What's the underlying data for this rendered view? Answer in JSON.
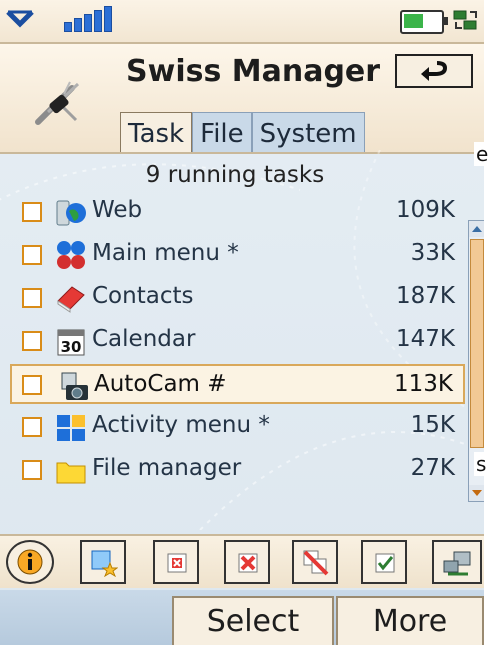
{
  "status_bar": {
    "signal_icon": "signal-strength-icon",
    "battery_level": 0.6
  },
  "header": {
    "title": "Swiss Manager",
    "back_icon": "back-arrow-icon"
  },
  "tabs": [
    {
      "label": "Task"
    },
    {
      "label": "File"
    },
    {
      "label": "System"
    }
  ],
  "active_tab": "Task",
  "summary": "9 running tasks",
  "tasks": [
    {
      "name": "Web",
      "size": "109K",
      "icon": "globe-phone-icon"
    },
    {
      "name": "Main menu *",
      "size": "33K",
      "icon": "main-menu-icon"
    },
    {
      "name": "Contacts",
      "size": "187K",
      "icon": "contacts-book-icon"
    },
    {
      "name": "Calendar",
      "size": "147K",
      "icon": "calendar-icon"
    },
    {
      "name": "AutoCam #",
      "size": "113K",
      "icon": "camera-icon"
    },
    {
      "name": "Activity menu *",
      "size": "15K",
      "icon": "activity-menu-icon"
    },
    {
      "name": "File manager",
      "size": "27K",
      "icon": "folder-icon"
    }
  ],
  "selected_task_index": 4,
  "edge_text": {
    "left_top": "e",
    "left_bottom": "s"
  },
  "toolbar": [
    "info-icon",
    "new-task-icon",
    "close-task-icon",
    "kill-task-icon",
    "kill-all-icon",
    "check-icon",
    "network-icon"
  ],
  "softkeys": {
    "select": "Select",
    "more": "More"
  },
  "colors": {
    "accent": "#d98c18",
    "selection_border": "#d9a85a",
    "text": "#243446",
    "tab_bg": "#c9d9e8"
  }
}
